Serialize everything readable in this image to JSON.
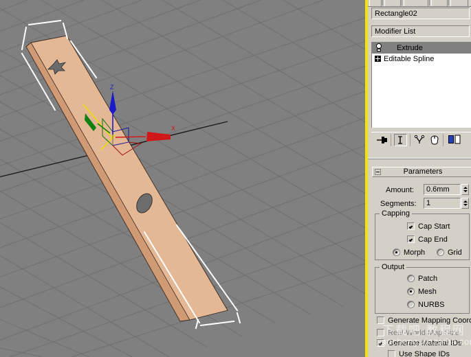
{
  "viewport": {
    "name": "perspective-viewport",
    "background_color": "#808080",
    "grid_color": "#6e6e6e",
    "object_color": "#e8b994",
    "object_shade_color": "#d9a179",
    "active_border_color": "#f2e400",
    "gizmo": {
      "z_label": "Z",
      "x_label": "X",
      "z_color": "#2020c0",
      "x_color": "#d01818",
      "y_color": "#108010",
      "highlight_color": "#e8e000"
    }
  },
  "command_panel": {
    "object_name": "Rectangle02",
    "modifier_list_label": "Modifier List",
    "stack": [
      {
        "label": "Extrude",
        "icon": "lightbulb-icon",
        "selected": true
      },
      {
        "label": "Editable Spline",
        "icon": "plus-box-icon",
        "selected": false
      }
    ],
    "stack_tools": [
      {
        "name": "pin-stack-icon"
      },
      {
        "name": "show-end-result-icon",
        "pressed": true
      },
      {
        "name": "make-unique-icon"
      },
      {
        "name": "remove-modifier-icon"
      },
      {
        "name": "configure-modifier-sets-icon"
      }
    ],
    "rollout": {
      "title": "Parameters",
      "amount_label": "Amount:",
      "amount_value": "0.6mm",
      "segments_label": "Segments:",
      "segments_value": "1",
      "capping": {
        "title": "Capping",
        "cap_start_label": "Cap Start",
        "cap_start_checked": true,
        "cap_end_label": "Cap End",
        "cap_end_checked": true,
        "morph_label": "Morph",
        "morph_selected": true,
        "grid_label": "Grid",
        "grid_selected": false
      },
      "output": {
        "title": "Output",
        "patch_label": "Patch",
        "patch_selected": false,
        "mesh_label": "Mesh",
        "mesh_selected": true,
        "nurbs_label": "NURBS",
        "nurbs_selected": false
      },
      "generate_mapping_label": "Generate Mapping Coord",
      "generate_mapping_checked": false,
      "real_world_label": "Real-World Map Size",
      "real_world_checked": false,
      "real_world_disabled": true,
      "generate_material_label": "Generate Material IDs",
      "generate_material_checked": true,
      "use_shape_label": "Use Shape IDs",
      "use_shape_checked": false
    }
  },
  "watermark": {
    "line1": "下载吧 教程网",
    "line2": "jiaocheng.xiazaiba.com"
  }
}
